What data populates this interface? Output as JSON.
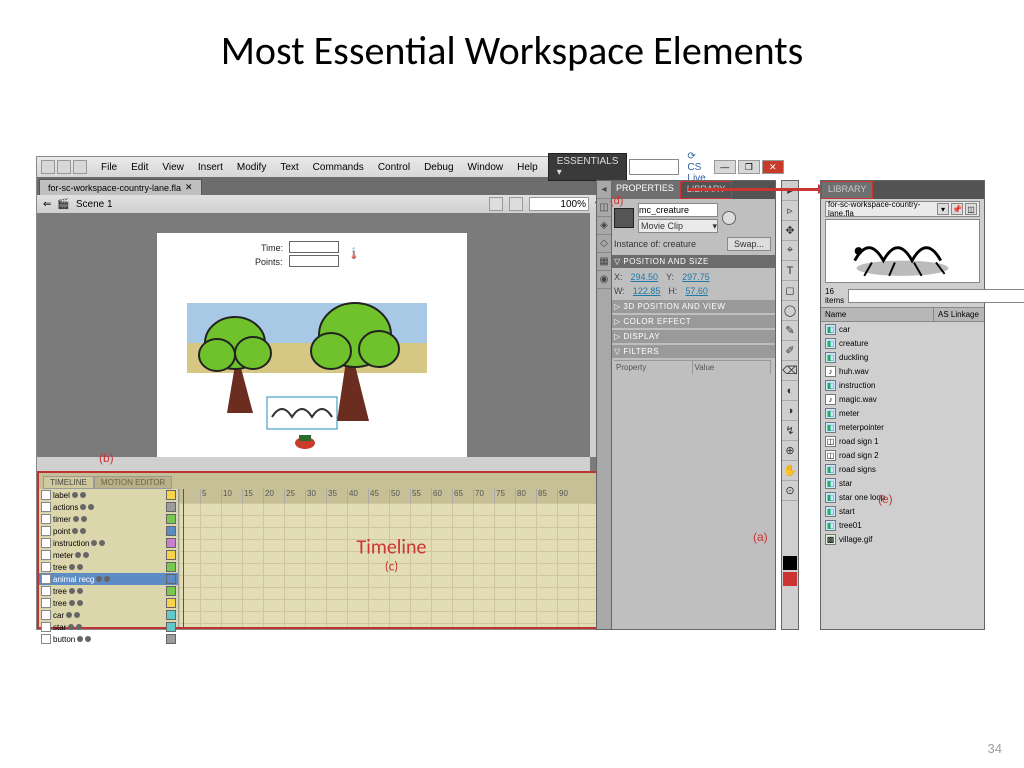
{
  "slide": {
    "title": "Most Essential Workspace Elements",
    "number": "34"
  },
  "menubar": {
    "items": [
      "File",
      "Edit",
      "View",
      "Insert",
      "Modify",
      "Text",
      "Commands",
      "Control",
      "Debug",
      "Window",
      "Help"
    ],
    "workspace": "ESSENTIALS ▾",
    "cslive": "⟳ CS Live"
  },
  "file_tab": "for-sc-workspace-country-lane.fla",
  "scene_bar": {
    "scene": "Scene 1",
    "zoom": "100%"
  },
  "stage": {
    "time": "Time:",
    "points": "Points:"
  },
  "timeline": {
    "tabs": [
      "TIMELINE",
      "MOTION EDITOR"
    ],
    "ticks": [
      "5",
      "10",
      "15",
      "20",
      "25",
      "30",
      "35",
      "40",
      "45",
      "50",
      "55",
      "60",
      "65",
      "70",
      "75",
      "80",
      "85",
      "90"
    ],
    "layers_full": [
      {
        "name": "label",
        "sw": "#f7d44c"
      },
      {
        "name": "actions",
        "sw": "#9c9c9c"
      },
      {
        "name": "timer",
        "sw": "#78c850"
      },
      {
        "name": "point",
        "sw": "#5d8bc4"
      },
      {
        "name": "instruction",
        "sw": "#c97fc9"
      },
      {
        "name": "meter",
        "sw": "#f7d44c"
      },
      {
        "name": "tree",
        "sw": "#78c850"
      },
      {
        "name": "animal recg",
        "sw": "#5d8bc4",
        "sel": true
      },
      {
        "name": "tree",
        "sw": "#78c850"
      },
      {
        "name": "tree",
        "sw": "#f7d44c"
      },
      {
        "name": "car",
        "sw": "#62c9c9"
      },
      {
        "name": "star",
        "sw": "#62c9c9"
      },
      {
        "name": "button",
        "sw": "#9c9c9c"
      }
    ],
    "overlay": "Timeline",
    "overlay_sub": "(c)"
  },
  "props": {
    "tabs": [
      "PROPERTIES",
      "LIBRARY"
    ],
    "instance_name": "mc_creature",
    "type_dd": "Movie Clip",
    "instance_of_label": "Instance of:",
    "instance_of": "creature",
    "swap": "Swap...",
    "sec_pos": "POSITION AND SIZE",
    "x_label": "X:",
    "x_val": "294.50",
    "y_label": "Y:",
    "y_val": "297.75",
    "w_label": "W:",
    "w_val": "122.85",
    "h_label": "H:",
    "h_val": "57.60",
    "sec_3d": "3D POSITION AND VIEW",
    "sec_color": "COLOR EFFECT",
    "sec_disp": "DISPLAY",
    "sec_filters": "FILTERS",
    "f_prop": "Property",
    "f_val": "Value"
  },
  "tools": [
    "▸",
    "▹",
    "✥",
    "⌖",
    "T",
    "◻",
    "◯",
    "✎",
    "✐",
    "⌫",
    "◐",
    "◑",
    "↯",
    "⊕",
    "✋",
    "⊙"
  ],
  "library": {
    "tab": "LIBRARY",
    "file": "for-sc-workspace-country-lane.fla",
    "count": "16 items",
    "head_name": "Name",
    "head_link": "AS Linkage",
    "items": [
      {
        "name": "car",
        "t": "mc"
      },
      {
        "name": "creature",
        "t": "mc"
      },
      {
        "name": "duckling",
        "t": "mc"
      },
      {
        "name": "huh.wav",
        "t": "snd"
      },
      {
        "name": "instruction",
        "t": "mc"
      },
      {
        "name": "magic.wav",
        "t": "snd"
      },
      {
        "name": "meter",
        "t": "mc"
      },
      {
        "name": "meterpointer",
        "t": "mc"
      },
      {
        "name": "road sign 1",
        "t": "gfx"
      },
      {
        "name": "road sign 2",
        "t": "gfx"
      },
      {
        "name": "road signs",
        "t": "mc"
      },
      {
        "name": "star",
        "t": "mc"
      },
      {
        "name": "star one loop",
        "t": "mc"
      },
      {
        "name": "start",
        "t": "mc"
      },
      {
        "name": "tree01",
        "t": "mc"
      },
      {
        "name": "village.gif",
        "t": "img"
      }
    ]
  },
  "ann": {
    "a": "(a)",
    "b": "(b)",
    "d": "(d)",
    "e": "(e)"
  }
}
